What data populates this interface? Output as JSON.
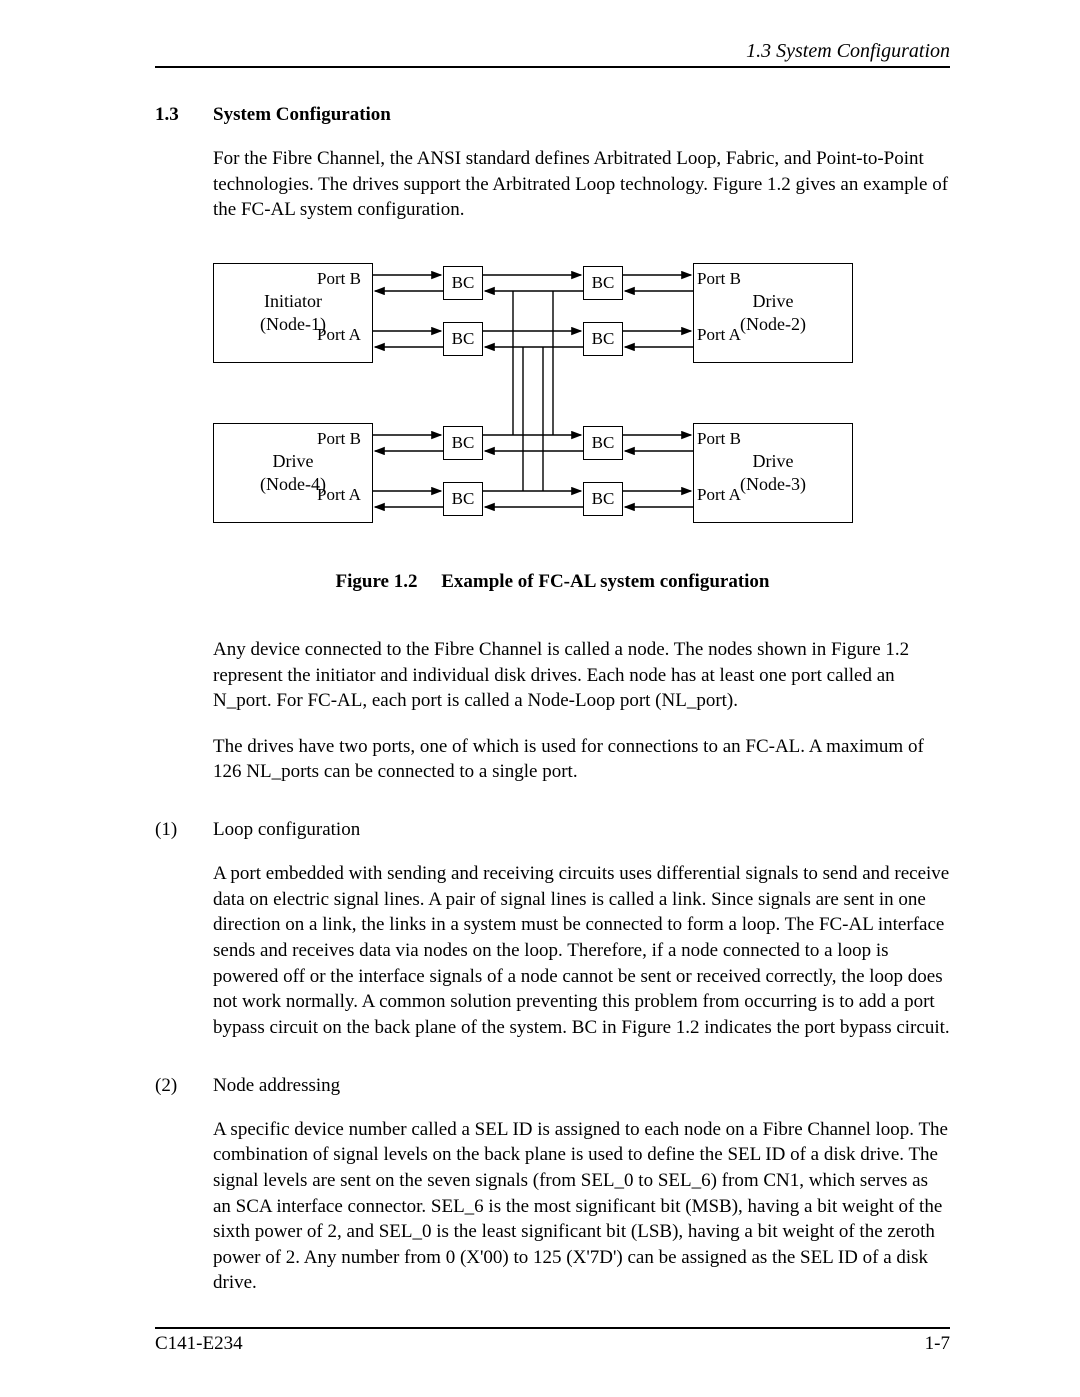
{
  "header": {
    "right": "1.3  System Configuration"
  },
  "section": {
    "number": "1.3",
    "title": "System Configuration"
  },
  "para1": "For the Fibre Channel, the ANSI standard defines Arbitrated Loop, Fabric, and Point-to-Point technologies.  The drives support the Arbitrated Loop technology.  Figure 1.2 gives an example of the FC-AL system configuration.",
  "figure": {
    "caption_prefix": "Figure 1.2",
    "caption_text": "Example of FC-AL system configuration",
    "nodes": {
      "n1_l1": "Initiator",
      "n1_l2": "(Node-1)",
      "n2_l1": "Drive",
      "n2_l2": "(Node-2)",
      "n3_l1": "Drive",
      "n3_l2": "(Node-3)",
      "n4_l1": "Drive",
      "n4_l2": "(Node-4)"
    },
    "port_b": "Port B",
    "port_a": "Port A",
    "bc": "BC"
  },
  "para2": "Any device connected to the Fibre Channel is called a node.  The nodes shown in Figure 1.2 represent the initiator and individual disk drives.  Each node has at least one port called an N_port.  For FC-AL, each port is called a Node-Loop port (NL_port).",
  "para3": "The drives have two ports, one of which is used for connections to an FC-AL.  A maximum of 126 NL_ports can be connected to a single port.",
  "sub1": {
    "num": "(1)",
    "title": "Loop configuration"
  },
  "para4": "A port embedded with sending and receiving circuits uses differential signals to send and receive data on electric signal lines.  A pair of signal lines is called a link.  Since signals are sent in one direction on a link, the links in a system must be connected to form a loop.  The FC-AL interface sends and receives data via nodes on the loop.  Therefore, if a node connected to a loop is powered off or the interface signals of a node cannot be sent or received correctly, the loop does not work normally.  A common solution preventing this problem from occurring is to add a port bypass circuit on the back plane of the system.  BC in Figure 1.2 indicates the port bypass circuit.",
  "sub2": {
    "num": "(2)",
    "title": "Node addressing"
  },
  "para5": "A specific device number called a SEL ID is assigned to each node on a Fibre Channel loop.  The combination of signal levels on the back plane is used to define the SEL ID of a disk drive.  The signal levels are sent on the seven signals (from SEL_0 to SEL_6) from CN1, which serves as an SCA interface connector.  SEL_6 is the most significant bit (MSB), having a bit weight of the sixth power of 2, and SEL_0 is the least significant bit (LSB), having a bit weight of the zeroth power of 2.  Any number from 0 (X'00) to 125 (X'7D') can be assigned as the SEL ID of a disk drive.",
  "footer": {
    "left": "C141-E234",
    "right": "1-7"
  }
}
